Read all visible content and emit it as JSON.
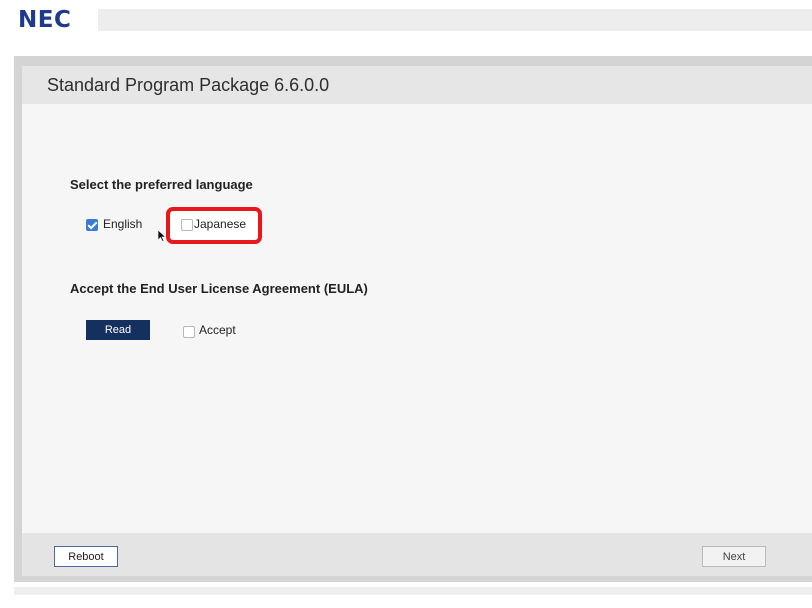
{
  "brand": {
    "logo": "NEC",
    "logo_color": "#1d3a8f"
  },
  "window": {
    "title": "Standard Program Package 6.6.0.0"
  },
  "language": {
    "heading": "Select the preferred language",
    "options": [
      {
        "label": "English",
        "checked": true
      },
      {
        "label": "Japanese",
        "checked": false,
        "highlighted": true
      }
    ],
    "highlight_color": "#e8171b"
  },
  "eula": {
    "heading": "Accept the End User License Agreement (EULA)",
    "read_label": "Read",
    "accept_label": "Accept",
    "accept_checked": false
  },
  "footer": {
    "reboot_label": "Reboot",
    "next_label": "Next"
  },
  "colors": {
    "checkbox_checked": "#3a7bd5",
    "read_button": "#14305f"
  }
}
